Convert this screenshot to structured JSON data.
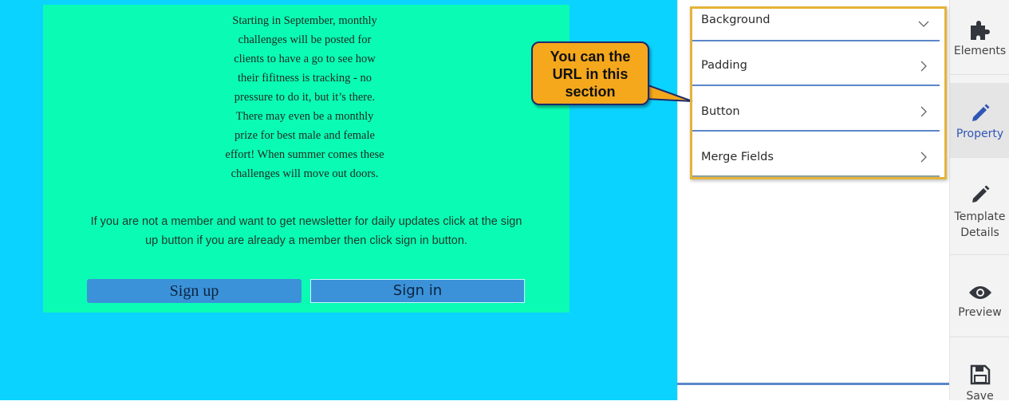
{
  "canvas": {
    "background_color": "#0bd3ff",
    "card_color": "#0afcb4",
    "body_text": "Starting in September, monthly challenges will be posted for clients to have a go to see how their fifitness is tracking - no pressure to do it, but it’s there. There may even be a monthly prize for best male and female effort! When summer comes these challenges will move out doors.",
    "note_text": "If you are not a member and want to get newsletter for daily updates click at the sign up button if you are already a member then click sign in button.",
    "buttons": {
      "signup_label": "Sign up",
      "signin_label": "Sign in",
      "color": "#3b92d8"
    }
  },
  "callout": {
    "text_line1": "You can the",
    "text_line2": "URL in this",
    "text_line3": "section",
    "color": "#f5a81c"
  },
  "property_panel": {
    "sections": [
      {
        "label": "Background",
        "icon": "chevron-down-icon",
        "expanded": true
      },
      {
        "label": "Padding",
        "icon": "chevron-right-icon",
        "expanded": false
      },
      {
        "label": "Button",
        "icon": "chevron-right-icon",
        "expanded": false
      },
      {
        "label": "Merge Fields",
        "icon": "chevron-right-icon",
        "expanded": false
      }
    ],
    "highlight_color": "#e5b339",
    "divider_color": "#5b87c9"
  },
  "sidebar": {
    "items": [
      {
        "label": "Elements",
        "icon": "puzzle-icon",
        "active": false
      },
      {
        "label": "Property",
        "icon": "pencil-icon",
        "active": true
      },
      {
        "label_line1": "Template",
        "label_line2": "Details",
        "icon": "pencil-icon",
        "active": false
      },
      {
        "label": "Preview",
        "icon": "eye-icon",
        "active": false
      },
      {
        "label": "Save",
        "icon": "floppy-disk-icon",
        "active": false
      }
    ],
    "active_color": "#2f56b6"
  }
}
